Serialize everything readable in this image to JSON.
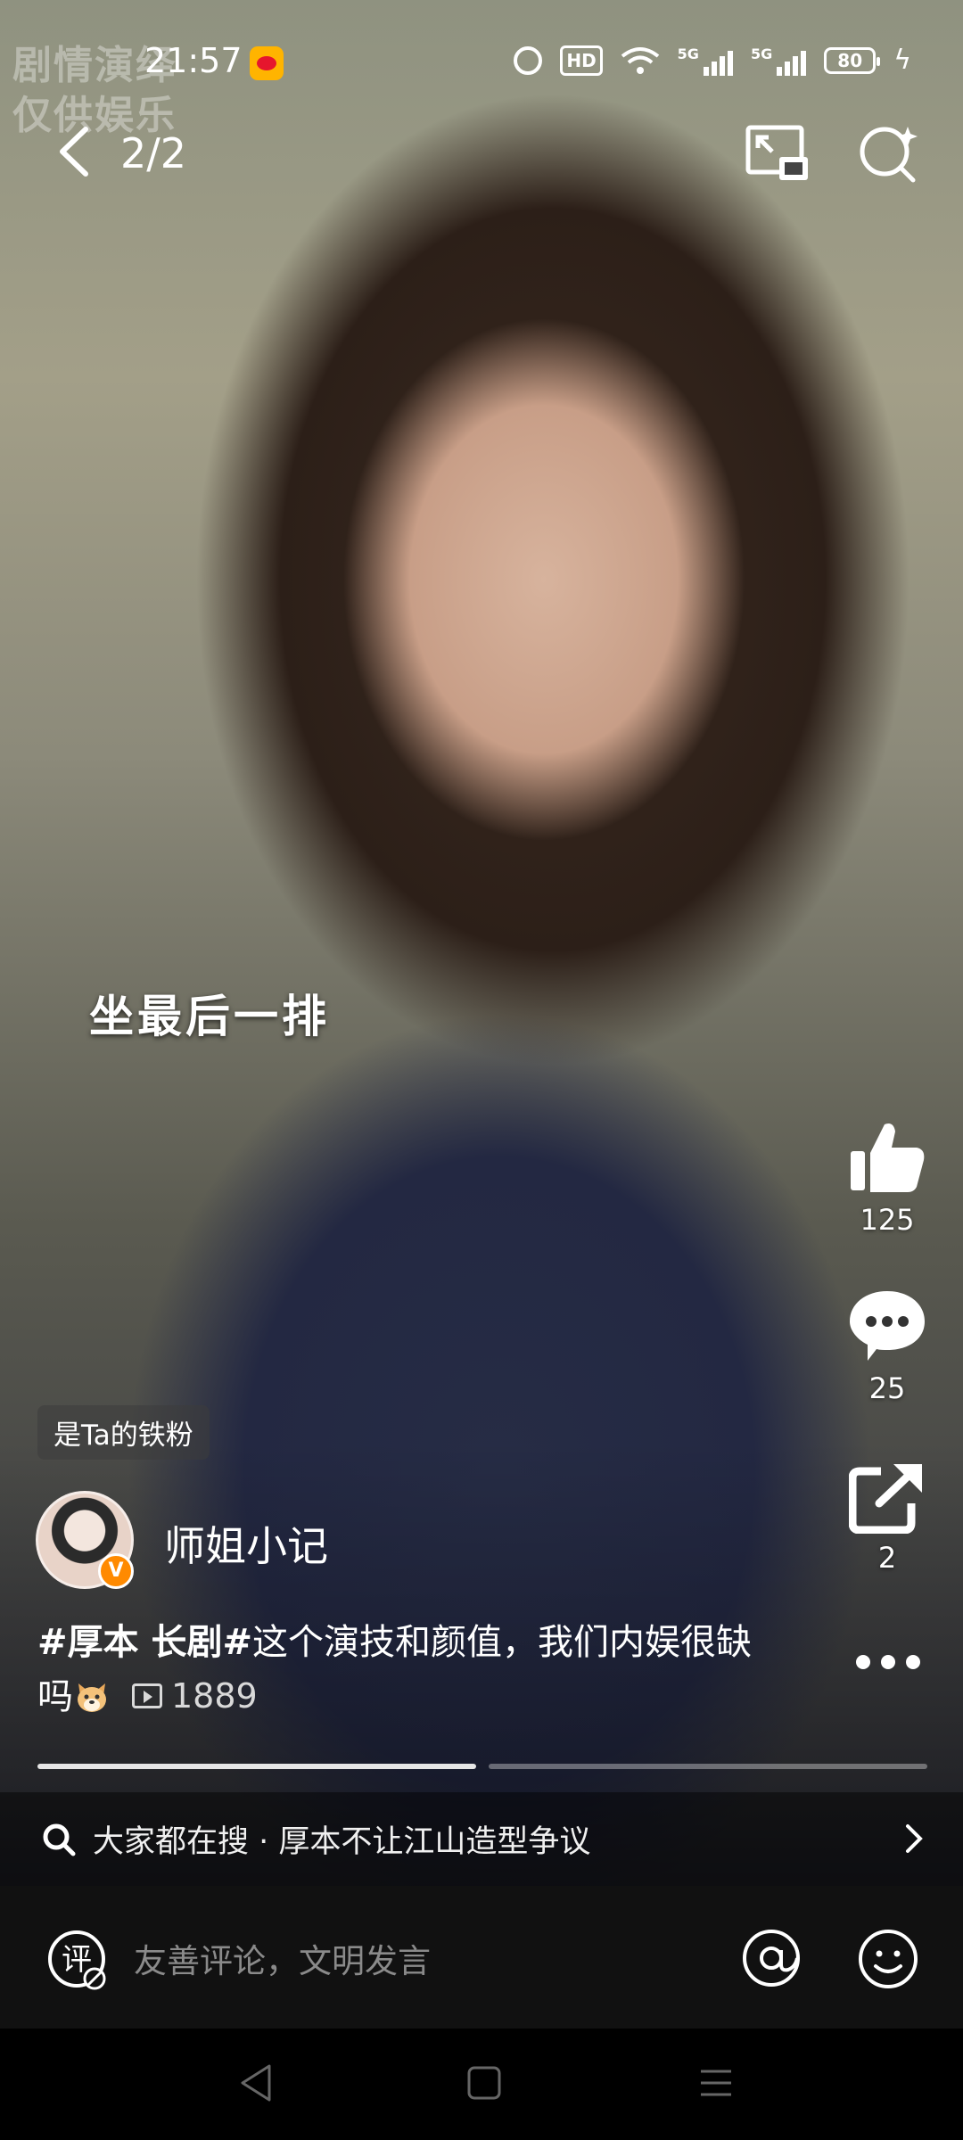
{
  "status_bar": {
    "time": "21:57",
    "hd_label": "HD",
    "network_label_1": "5G",
    "network_label_2": "5G",
    "battery": "80"
  },
  "watermark": {
    "line1": "剧情演绎",
    "line2": "仅供娱乐"
  },
  "header": {
    "page_counter": "2/2"
  },
  "video": {
    "caption": "坐最后一排"
  },
  "actions": {
    "like_count": "125",
    "comment_count": "25",
    "share_count": "2"
  },
  "author": {
    "fan_badge": "是Ta的铁粉",
    "name": "师姐小记",
    "verified_mark": "V"
  },
  "post": {
    "hashtag": "#厚本 长剧#",
    "text": "这个演技和颜值，我们内娱很缺吗",
    "view_count": "1889"
  },
  "progress": {
    "segments": 2,
    "current_segment": 1
  },
  "search_hint": {
    "text": "大家都在搜 · 厚本不让江山造型争议"
  },
  "comment_bar": {
    "placeholder": "友善评论，文明发言",
    "comment_icon_char": "评"
  },
  "colors": {
    "accent_orange": "#ff8a00",
    "weibo_yellow": "#ffb400",
    "weibo_red": "#e6162d"
  }
}
